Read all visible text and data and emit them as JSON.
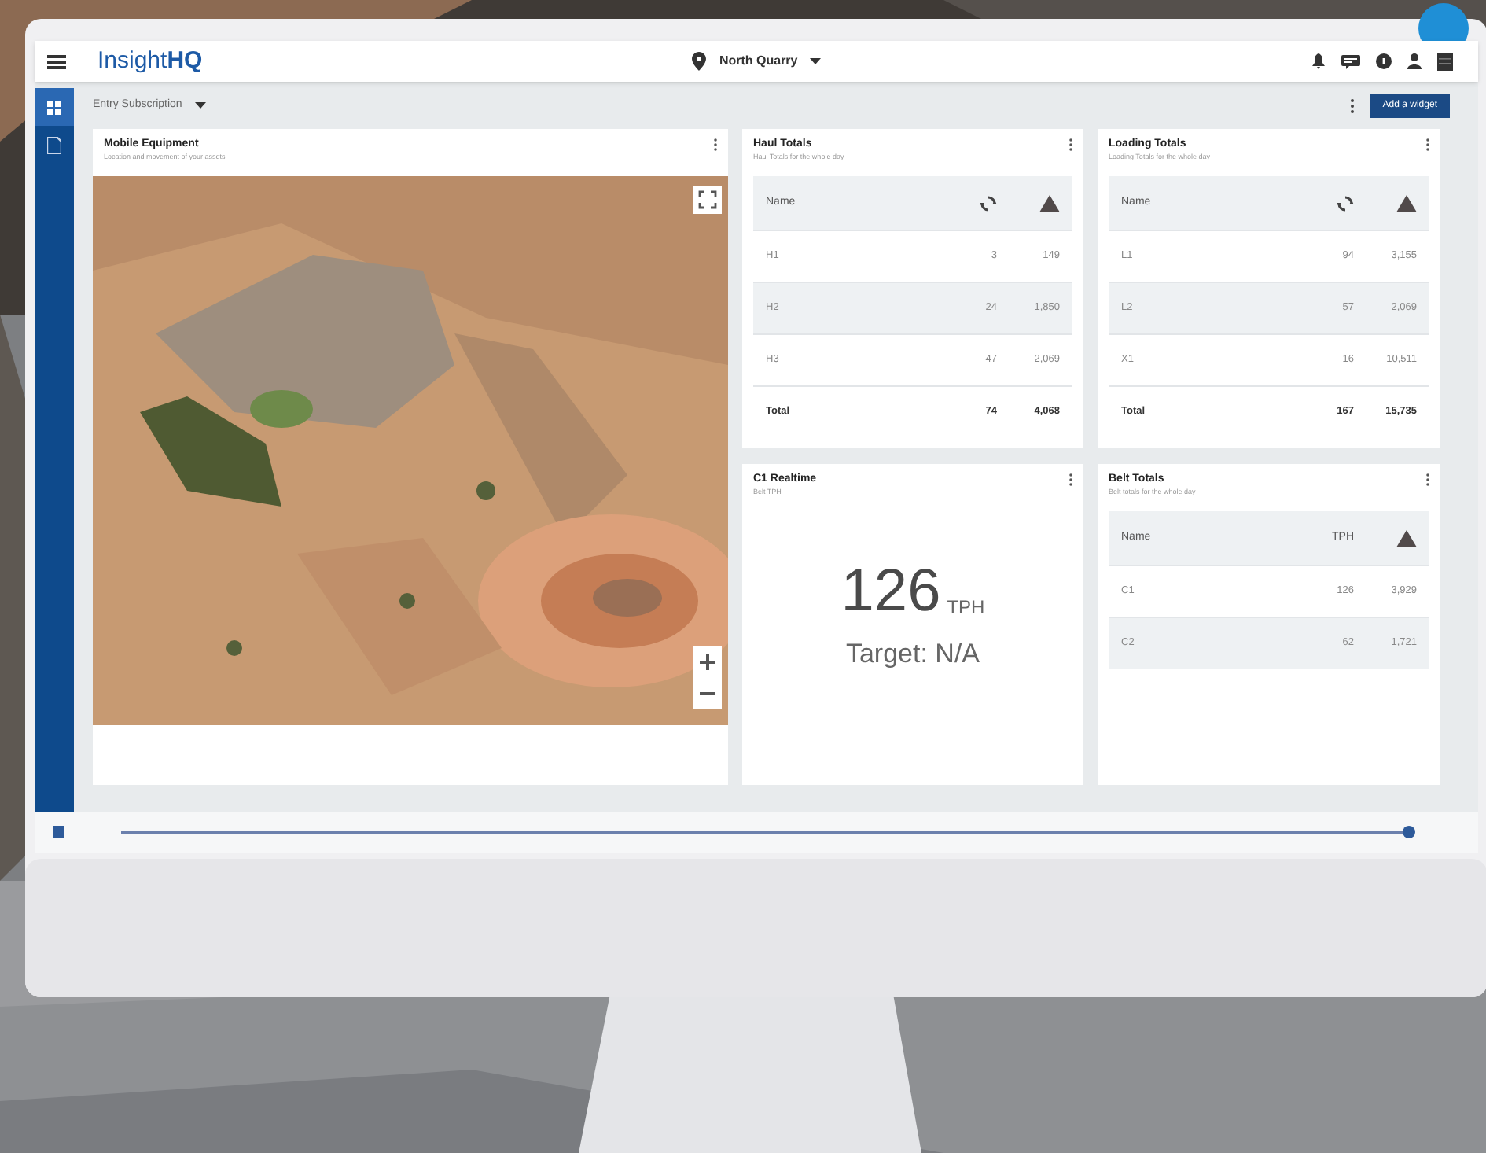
{
  "header": {
    "logo_plain": "Insight",
    "logo_bold": "HQ",
    "site": "North Quarry"
  },
  "sidebar": {
    "items": [
      {
        "selected": true
      },
      {
        "selected": false
      }
    ]
  },
  "toolbar": {
    "subscription": "Entry Subscription",
    "button": "Add a widget"
  },
  "widgets": [
    {
      "kind": "map",
      "title": "Mobile Equipment",
      "subtitle": "Location and movement of your assets"
    },
    {
      "kind": "table",
      "title": "Haul Totals",
      "subtitle": "Haul Totals for the whole day",
      "columns": [
        {
          "kind": "text",
          "label": "Name"
        },
        {
          "kind": "cycles"
        },
        {
          "kind": "pile"
        }
      ],
      "rows": [
        {
          "cells": [
            "H1",
            "3",
            "149"
          ],
          "total": false
        },
        {
          "cells": [
            "H2",
            "24",
            "1,850"
          ],
          "total": false
        },
        {
          "cells": [
            "H3",
            "47",
            "2,069"
          ],
          "total": false
        },
        {
          "cells": [
            "Total",
            "74",
            "4,068"
          ],
          "total": true
        }
      ]
    },
    {
      "kind": "table",
      "title": "Loading Totals",
      "subtitle": "Loading Totals for the whole day",
      "columns": [
        {
          "kind": "text",
          "label": "Name"
        },
        {
          "kind": "cycles"
        },
        {
          "kind": "pile"
        }
      ],
      "rows": [
        {
          "cells": [
            "L1",
            "94",
            "3,155"
          ],
          "total": false
        },
        {
          "cells": [
            "L2",
            "57",
            "2,069"
          ],
          "total": false
        },
        {
          "cells": [
            "X1",
            "16",
            "10,511"
          ],
          "total": false
        },
        {
          "cells": [
            "Total",
            "167",
            "15,735"
          ],
          "total": true
        }
      ]
    },
    {
      "kind": "realtime",
      "title": "C1 Realtime",
      "subtitle": "Belt TPH",
      "value": "126",
      "unit": "TPH",
      "target": "Target: N/A"
    },
    {
      "kind": "table",
      "title": "Belt Totals",
      "subtitle": "Belt totals for the whole day",
      "columns": [
        {
          "kind": "text",
          "label": "Name"
        },
        {
          "kind": "text",
          "label": "TPH"
        },
        {
          "kind": "pile"
        }
      ],
      "rows": [
        {
          "cells": [
            "C1",
            "126",
            "3,929"
          ],
          "total": false
        },
        {
          "cells": [
            "C2",
            "62",
            "1,721"
          ],
          "total": false
        }
      ]
    }
  ],
  "timeline": {
    "level": 1
  }
}
